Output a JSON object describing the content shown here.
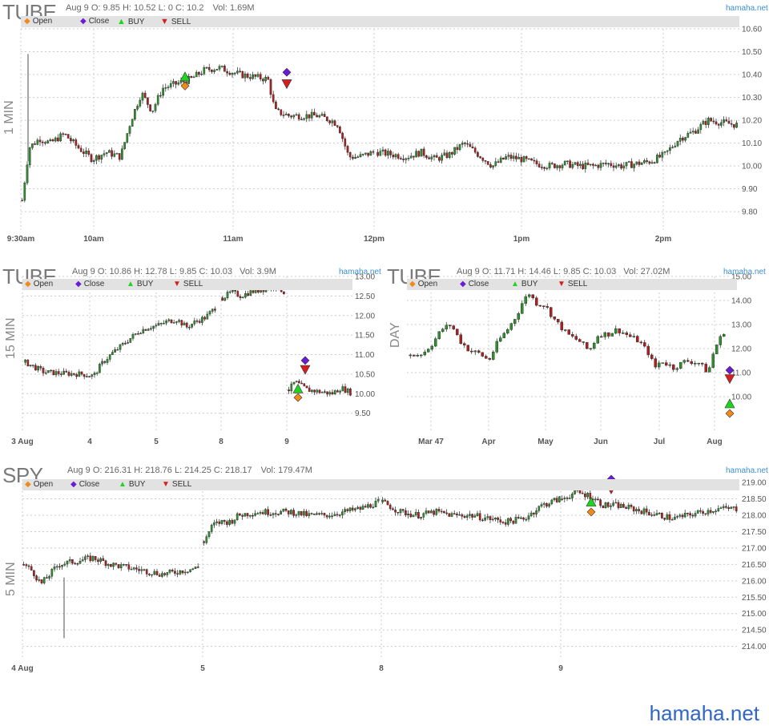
{
  "watermark": "hamaha.net",
  "colors": {
    "up": "#2f8f2f",
    "down": "#b01f1f",
    "grid": "#cccccc",
    "open": "#f28a1a",
    "close": "#6a1bd6",
    "buy": "#1fd41f",
    "sell": "#d41f1f",
    "brand": "#3b8fd0"
  },
  "legend": {
    "open": "Open",
    "close": "Close",
    "buy": "BUY",
    "sell": "SELL"
  },
  "panels": [
    {
      "symbol": "TUBE",
      "timeframe": "1 MIN",
      "info": {
        "date": "Aug 9",
        "o": "O: 9.85",
        "h": "H: 10.52",
        "l": "L: 0",
        "c": "C: 10.2",
        "vol": "Vol: 1.69M"
      },
      "brand": "hamaha.net"
    },
    {
      "symbol": "TUBE",
      "timeframe": "15 MIN",
      "info": {
        "date": "Aug 9",
        "o": "O: 10.86",
        "h": "H: 12.78",
        "l": "L: 9.85",
        "c": "C: 10.03",
        "vol": "Vol: 3.9M"
      },
      "brand": "hamaha.net"
    },
    {
      "symbol": "TUBE",
      "timeframe": "DAY",
      "info": {
        "date": "Aug 9",
        "o": "O: 11.71",
        "h": "H: 14.46",
        "l": "L: 9.85",
        "c": "C: 10.03",
        "vol": "Vol: 27.02M"
      },
      "brand": "hamaha.net"
    },
    {
      "symbol": "SPY",
      "timeframe": "5 MIN",
      "info": {
        "date": "Aug 9",
        "o": "O: 216.31",
        "h": "H: 218.76",
        "l": "L: 214.25",
        "c": "C: 218.17",
        "vol": "Vol: 179.47M"
      },
      "brand": "hamaha.net"
    }
  ],
  "chart_data": [
    {
      "type": "candlestick",
      "symbol": "TUBE",
      "timeframe": "1 MIN",
      "x_ticks": [
        "9:30am",
        "10am",
        "11am",
        "12pm",
        "1pm",
        "2pm"
      ],
      "y_ticks": [
        "9.80",
        "9.90",
        "10.00",
        "10.10",
        "10.20",
        "10.30",
        "10.40",
        "10.50",
        "10.60"
      ],
      "ylim": [
        9.72,
        10.6
      ],
      "grid": true,
      "legend_position": "top-left",
      "path": [
        [
          0,
          9.85
        ],
        [
          0.02,
          10.08
        ],
        [
          0.05,
          10.12
        ],
        [
          0.08,
          10.1
        ],
        [
          0.12,
          10.14
        ],
        [
          0.16,
          10.08
        ],
        [
          0.2,
          10.03
        ],
        [
          0.24,
          10.06
        ],
        [
          0.28,
          10.04
        ],
        [
          0.31,
          10.2
        ],
        [
          0.34,
          10.32
        ],
        [
          0.37,
          10.24
        ],
        [
          0.4,
          10.34
        ],
        [
          0.44,
          10.36
        ],
        [
          0.48,
          10.38
        ],
        [
          0.52,
          10.42
        ],
        [
          0.56,
          10.43
        ],
        [
          0.6,
          10.41
        ],
        [
          0.62,
          10.4
        ],
        [
          0.66,
          10.39
        ],
        [
          0.7,
          10.38
        ],
        [
          0.72,
          10.24
        ],
        [
          0.76,
          10.22
        ],
        [
          0.8,
          10.22
        ],
        [
          0.84,
          10.22
        ],
        [
          0.88,
          10.2
        ],
        [
          0.9,
          10.18
        ],
        [
          0.93,
          10.04
        ],
        [
          0.96,
          10.04
        ],
        [
          1.0,
          10.06
        ]
      ],
      "path2": [
        [
          0,
          10.06
        ],
        [
          0.04,
          10.05
        ],
        [
          0.08,
          10.04
        ],
        [
          0.12,
          10.06
        ],
        [
          0.16,
          10.03
        ],
        [
          0.2,
          10.05
        ],
        [
          0.24,
          10.1
        ],
        [
          0.28,
          10.05
        ],
        [
          0.32,
          10.0
        ],
        [
          0.36,
          10.04
        ],
        [
          0.4,
          10.03
        ],
        [
          0.44,
          10.01
        ],
        [
          0.48,
          10.0
        ],
        [
          0.52,
          10.01
        ],
        [
          0.56,
          10.0
        ],
        [
          0.6,
          10.0
        ],
        [
          0.64,
          10.01
        ],
        [
          0.68,
          10.0
        ],
        [
          0.72,
          10.01
        ],
        [
          0.76,
          10.02
        ],
        [
          0.8,
          10.05
        ],
        [
          0.84,
          10.12
        ],
        [
          0.88,
          10.15
        ],
        [
          0.92,
          10.2
        ],
        [
          1.0,
          10.18
        ]
      ],
      "markers": [
        {
          "kind": "open",
          "t": 0.28,
          "v": 10.35
        },
        {
          "kind": "buy",
          "t": 0.28,
          "v": 10.39
        },
        {
          "kind": "close",
          "t": 0.45,
          "v": 10.41
        },
        {
          "kind": "sell",
          "t": 0.45,
          "v": 10.36
        }
      ]
    },
    {
      "type": "candlestick",
      "symbol": "TUBE",
      "timeframe": "15 MIN",
      "x_ticks": [
        "3 Aug",
        "4",
        "5",
        "8",
        "9"
      ],
      "y_ticks": [
        "9.50",
        "10.00",
        "10.50",
        "11.00",
        "11.50",
        "12.00",
        "12.50",
        "13.00"
      ],
      "ylim": [
        9.0,
        13.0
      ],
      "grid": true,
      "legend_position": "top-left",
      "path": [
        [
          0,
          10.8
        ],
        [
          0.1,
          10.55
        ],
        [
          0.2,
          10.52
        ],
        [
          0.3,
          10.5
        ],
        [
          0.36,
          10.45
        ],
        [
          0.4,
          10.75
        ],
        [
          0.45,
          11.0
        ],
        [
          0.5,
          11.2
        ],
        [
          0.55,
          11.4
        ],
        [
          0.6,
          11.6
        ],
        [
          0.65,
          11.7
        ],
        [
          0.7,
          11.75
        ],
        [
          0.75,
          11.85
        ],
        [
          0.8,
          11.9
        ],
        [
          0.85,
          11.7
        ],
        [
          0.9,
          11.85
        ],
        [
          0.95,
          11.95
        ],
        [
          1.0,
          12.2
        ]
      ],
      "path2": [
        [
          0,
          12.45
        ],
        [
          0.15,
          12.6
        ],
        [
          0.3,
          12.5
        ],
        [
          0.45,
          12.6
        ],
        [
          0.6,
          12.65
        ],
        [
          0.75,
          12.7
        ],
        [
          0.88,
          12.75
        ],
        [
          1.0,
          12.6
        ]
      ],
      "path3": [
        [
          0,
          10.1
        ],
        [
          0.1,
          10.3
        ],
        [
          0.2,
          10.2
        ],
        [
          0.3,
          10.1
        ],
        [
          0.5,
          10.05
        ],
        [
          0.7,
          10.0
        ],
        [
          0.85,
          10.15
        ],
        [
          1.0,
          10.03
        ]
      ],
      "markers": [
        {
          "kind": "open",
          "t": 0.2,
          "v": 9.9
        },
        {
          "kind": "buy",
          "t": 0.2,
          "v": 10.12
        },
        {
          "kind": "close",
          "t": 0.3,
          "v": 10.85
        },
        {
          "kind": "sell",
          "t": 0.3,
          "v": 10.62
        }
      ]
    },
    {
      "type": "candlestick",
      "symbol": "TUBE",
      "timeframe": "DAY",
      "x_ticks": [
        "Mar 47",
        "Apr",
        "May",
        "Jun",
        "Jul",
        "Aug"
      ],
      "y_ticks": [
        "10.00",
        "11.00",
        "12.00",
        "13.00",
        "14.00",
        "15.00"
      ],
      "ylim": [
        8.5,
        15.0
      ],
      "grid": true,
      "legend_position": "top-left",
      "path": [
        [
          0,
          11.7
        ],
        [
          0.04,
          11.8
        ],
        [
          0.07,
          12.2
        ],
        [
          0.1,
          12.8
        ],
        [
          0.13,
          13.0
        ],
        [
          0.16,
          12.3
        ],
        [
          0.19,
          11.9
        ],
        [
          0.22,
          11.8
        ],
        [
          0.25,
          11.5
        ],
        [
          0.28,
          12.3
        ],
        [
          0.31,
          12.8
        ],
        [
          0.34,
          13.4
        ],
        [
          0.36,
          14.0
        ],
        [
          0.38,
          14.3
        ],
        [
          0.4,
          13.9
        ],
        [
          0.43,
          13.8
        ],
        [
          0.46,
          13.2
        ],
        [
          0.5,
          12.6
        ],
        [
          0.54,
          12.3
        ],
        [
          0.57,
          11.9
        ],
        [
          0.6,
          12.6
        ],
        [
          0.63,
          12.6
        ],
        [
          0.66,
          12.8
        ],
        [
          0.7,
          12.5
        ],
        [
          0.73,
          12.3
        ],
        [
          0.76,
          11.8
        ],
        [
          0.78,
          11.2
        ],
        [
          0.8,
          11.5
        ],
        [
          0.84,
          11.2
        ],
        [
          0.88,
          11.5
        ],
        [
          0.92,
          11.4
        ],
        [
          0.95,
          11.0
        ],
        [
          0.97,
          12.0
        ],
        [
          1.0,
          12.7
        ]
      ],
      "markers": [
        {
          "kind": "open",
          "t": 1.0,
          "v": 9.3
        },
        {
          "kind": "buy",
          "t": 1.0,
          "v": 9.7
        },
        {
          "kind": "close",
          "t": 1.0,
          "v": 11.1
        },
        {
          "kind": "sell",
          "t": 1.0,
          "v": 10.75
        }
      ]
    },
    {
      "type": "candlestick",
      "symbol": "SPY",
      "timeframe": "5 MIN",
      "x_ticks": [
        "4 Aug",
        "5",
        "8",
        "9"
      ],
      "y_ticks": [
        "214.00",
        "214.50",
        "215.00",
        "215.50",
        "216.00",
        "216.50",
        "217.00",
        "217.50",
        "218.00",
        "218.50",
        "219.00"
      ],
      "ylim": [
        213.6,
        219.1
      ],
      "grid": true,
      "legend_position": "top-left",
      "path": [
        [
          0,
          216.5
        ],
        [
          0.05,
          216.3
        ],
        [
          0.1,
          215.9
        ],
        [
          0.15,
          216.2
        ],
        [
          0.2,
          216.5
        ],
        [
          0.3,
          216.6
        ],
        [
          0.4,
          216.7
        ],
        [
          0.5,
          216.5
        ],
        [
          0.6,
          216.4
        ],
        [
          0.7,
          216.3
        ],
        [
          0.8,
          216.2
        ],
        [
          0.9,
          216.3
        ],
        [
          1.0,
          216.4
        ]
      ],
      "path2": [
        [
          0,
          217.2
        ],
        [
          0.05,
          217.7
        ],
        [
          0.1,
          217.8
        ],
        [
          0.15,
          217.8
        ],
        [
          0.2,
          218.0
        ],
        [
          0.3,
          218.1
        ],
        [
          0.4,
          218.1
        ],
        [
          0.5,
          218.1
        ],
        [
          0.6,
          218.0
        ],
        [
          0.7,
          218.0
        ],
        [
          0.8,
          218.1
        ],
        [
          0.9,
          218.2
        ],
        [
          1.0,
          218.4
        ]
      ],
      "path3": [
        [
          0,
          218.4
        ],
        [
          0.1,
          218.1
        ],
        [
          0.2,
          218.0
        ],
        [
          0.3,
          218.1
        ],
        [
          0.4,
          218.0
        ],
        [
          0.5,
          218.0
        ],
        [
          0.6,
          217.9
        ],
        [
          0.7,
          217.8
        ],
        [
          0.8,
          217.9
        ],
        [
          0.9,
          218.3
        ],
        [
          1.0,
          218.5
        ]
      ],
      "path4": [
        [
          0,
          218.5
        ],
        [
          0.08,
          218.7
        ],
        [
          0.16,
          218.6
        ],
        [
          0.24,
          218.3
        ],
        [
          0.32,
          218.3
        ],
        [
          0.4,
          218.2
        ],
        [
          0.48,
          218.1
        ],
        [
          0.56,
          218.0
        ],
        [
          0.64,
          217.9
        ],
        [
          0.72,
          218.0
        ],
        [
          0.8,
          218.1
        ],
        [
          0.9,
          218.2
        ],
        [
          1.0,
          218.2
        ]
      ],
      "markers": [
        {
          "kind": "open",
          "t": 0.15,
          "v": 218.1
        },
        {
          "kind": "buy",
          "t": 0.15,
          "v": 218.4
        },
        {
          "kind": "close",
          "t": 0.25,
          "v": 219.1
        },
        {
          "kind": "sell",
          "t": 0.25,
          "v": 218.8
        }
      ]
    }
  ]
}
